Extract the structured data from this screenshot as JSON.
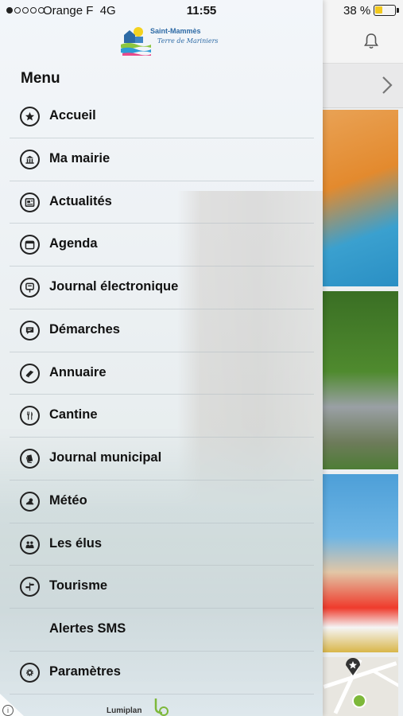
{
  "status_bar": {
    "signal_bars": 1,
    "signal_total": 5,
    "carrier": "Orange F",
    "network": "4G",
    "time": "11:55",
    "battery_percent": "38 %",
    "battery_level": 0.38,
    "battery_color": "#f2c81c"
  },
  "header": {
    "logo_name": "Saint-Mammès",
    "logo_tagline": "Terre de Mariniers"
  },
  "menu": {
    "title": "Menu",
    "items": [
      {
        "label": "Accueil",
        "icon": "star-icon"
      },
      {
        "label": "Ma mairie",
        "icon": "town-hall-icon"
      },
      {
        "label": "Actualités",
        "icon": "news-icon"
      },
      {
        "label": "Agenda",
        "icon": "calendar-icon"
      },
      {
        "label": "Journal électronique",
        "icon": "display-board-icon"
      },
      {
        "label": "Démarches",
        "icon": "chat-bubble-icon"
      },
      {
        "label": "Annuaire",
        "icon": "book-icon"
      },
      {
        "label": "Cantine",
        "icon": "cutlery-icon"
      },
      {
        "label": "Journal municipal",
        "icon": "magazine-icon"
      },
      {
        "label": "Météo",
        "icon": "weather-icon"
      },
      {
        "label": "Les élus",
        "icon": "people-icon"
      },
      {
        "label": "Tourisme",
        "icon": "signpost-icon"
      },
      {
        "label": "Alertes SMS",
        "icon": ""
      },
      {
        "label": "Paramètres",
        "icon": "gear-icon"
      }
    ]
  },
  "footer": {
    "brand": "Lumiplan",
    "info_icon": "info-icon"
  },
  "background": {
    "header_icon": "bell-icon",
    "nav_icon": "chevron-right-icon",
    "accent_orange": "#e38a2e",
    "accent_blue": "#2a8fc4"
  }
}
